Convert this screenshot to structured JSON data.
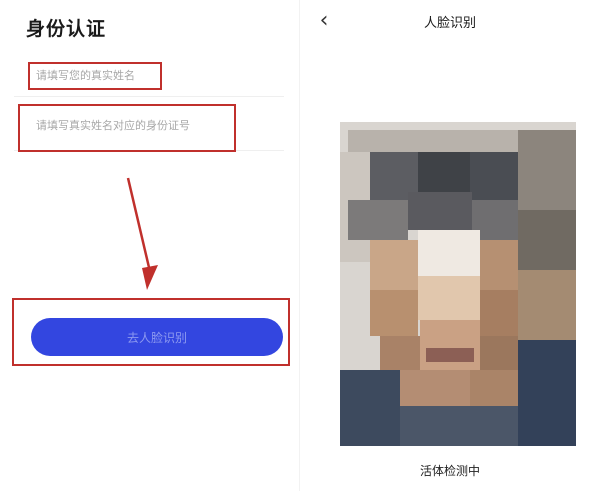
{
  "left": {
    "title": "身份认证",
    "name_field": {
      "placeholder": "请填写您的真实姓名",
      "value": ""
    },
    "id_field": {
      "placeholder": "请填写真实姓名对应的身份证号",
      "value": ""
    },
    "submit_label": "去人脸识别",
    "colors": {
      "button": "#3346e0",
      "highlight": "#c0302c"
    }
  },
  "right": {
    "back_icon": "chevron-left-icon",
    "title": "人脸识别",
    "status": "活体检测中"
  }
}
